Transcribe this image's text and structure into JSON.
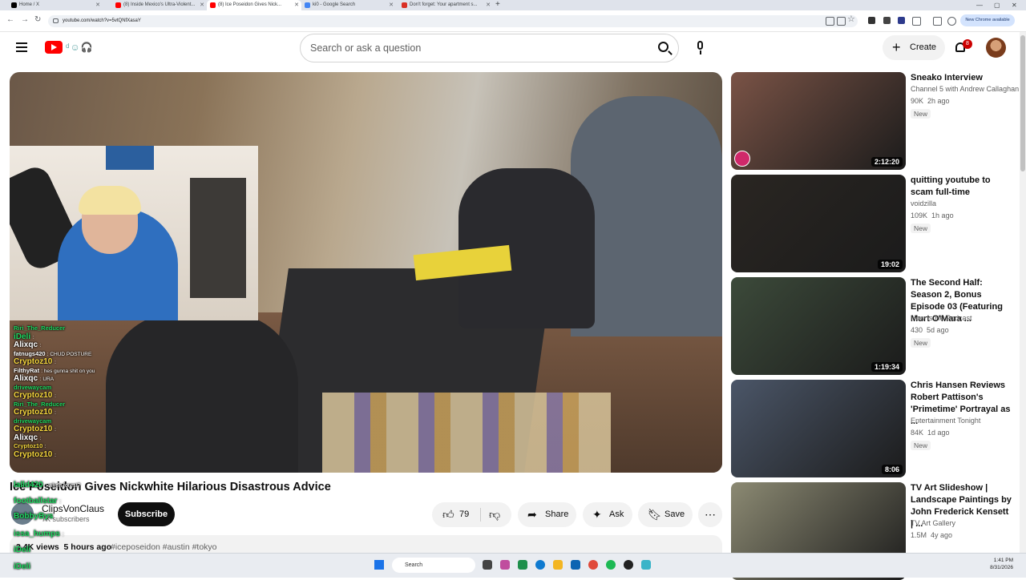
{
  "browser": {
    "tabs": [
      {
        "title": "Home / X",
        "color": "#000000"
      },
      {
        "title": "(8) Inside Mexico's Ultra-Violent...",
        "color": "#ff0000"
      },
      {
        "title": "(8) Ice Poseidon Gives Nick...",
        "color": "#ff0000"
      },
      {
        "title": "ki0 - Google Search",
        "color": "#4285f4"
      },
      {
        "title": "Don't forget: Your apartment s...",
        "color": "#d93025"
      }
    ],
    "url": "youtube.com/watch?v=5vtQNfXasaY",
    "new_chrome_badge": "New Chrome available"
  },
  "header": {
    "search_placeholder": "Search or ask a question",
    "create_label": "Create",
    "notification_count": "8",
    "doodle": "ᵈ☺🎧"
  },
  "video": {
    "title": "Ice Poseidon Gives Nickwhite Hilarious Disastrous Advice",
    "channel": "ClipsVonClaus",
    "subscribers": "7K subscribers",
    "subscribe_label": "Subscribe",
    "likes": "79",
    "share_label": "Share",
    "ask_label": "Ask",
    "save_label": "Save",
    "views": "3.4K views",
    "posted": "5 hours ago",
    "tags": "#iceposeidon #austin #tokyo"
  },
  "chat": [
    {
      "name": "Riri_The_Reducer",
      "text": "",
      "cls": "nm-green",
      "small": true
    },
    {
      "name": "iDeli",
      "text": ":",
      "cls": "nm-green"
    },
    {
      "name": "Alixqc",
      "text": ":",
      "cls": ""
    },
    {
      "name": "fatnugs420",
      "text": ": CHUD POSTURE",
      "cls": "",
      "small": true
    },
    {
      "name": "Cryptoz10",
      "text": ":",
      "cls": "nm-yellow"
    },
    {
      "name": "FilthyRat",
      "text": ": hes gunna shit on you",
      "cls": "",
      "small": true
    },
    {
      "name": "Alixqc",
      "text": ": URA",
      "cls": ""
    },
    {
      "name": "drivewaycam",
      "text": "",
      "cls": "nm-green",
      "small": true
    },
    {
      "name": "Cryptoz10",
      "text": ":",
      "cls": "nm-yellow"
    },
    {
      "name": "Riri_The_Reducer",
      "text": "",
      "cls": "nm-green",
      "small": true
    },
    {
      "name": "Cryptoz10",
      "text": ":",
      "cls": "nm-yellow"
    },
    {
      "name": "drivewaycam",
      "text": "",
      "cls": "nm-green",
      "small": true
    },
    {
      "name": "Cryptoz10",
      "text": ":",
      "cls": "nm-yellow"
    },
    {
      "name": "Alixqc",
      "text": ":",
      "cls": ""
    },
    {
      "name": "Cryptoz10",
      "text": ":",
      "cls": "nm-yellow",
      "small": true
    },
    {
      "name": "Cryptoz10",
      "text": ":",
      "cls": "nm-yellow"
    }
  ],
  "chat_overflow": [
    {
      "name": "lalld420",
      "text": ": when forest?"
    },
    {
      "name": "footballstar",
      "text": ":"
    },
    {
      "name": "BobbyBys",
      "text": ""
    },
    {
      "name": "issa_humps",
      "text": ":"
    },
    {
      "name": "iDeli",
      "text": ""
    },
    {
      "name": "iDeli",
      "text": ""
    }
  ],
  "recommendations": [
    {
      "title": "Sneako Interview",
      "channel": "Channel 5 with Andrew Callaghan",
      "views": "90K",
      "age": "2h ago",
      "badge": "New",
      "duration": "2:12:20",
      "thumb": "#7a5346"
    },
    {
      "title": "quitting youtube to scam full-time",
      "channel": "voidzilla",
      "views": "109K",
      "age": "1h ago",
      "badge": "New",
      "duration": "19:02",
      "thumb": "#2a2622"
    },
    {
      "title": "The Second Half: Season 2, Bonus Episode 03 (Featuring Murt O'Mara ...",
      "channel": "How Is He Podcast",
      "views": "430",
      "age": "5d ago",
      "badge": "New",
      "duration": "1:19:34",
      "thumb": "#3c4a3a"
    },
    {
      "title": "Chris Hansen Reviews Robert Pattison's 'Primetime' Portrayal as ...",
      "channel": "Entertainment Tonight",
      "views": "84K",
      "age": "1d ago",
      "badge": "New",
      "duration": "8:06",
      "thumb": "#4b5668"
    },
    {
      "title": "TV Art Slideshow | Landscape Paintings by John Frederick Kensett | ...",
      "channel": "TV Art Gallery",
      "views": "1.5M",
      "age": "4y ago",
      "badge": "",
      "duration": "",
      "thumb": "#8c8a73"
    }
  ],
  "taskbar": {
    "search_label": "Search",
    "time": "1:41 PM",
    "date": "8/31/2026"
  }
}
